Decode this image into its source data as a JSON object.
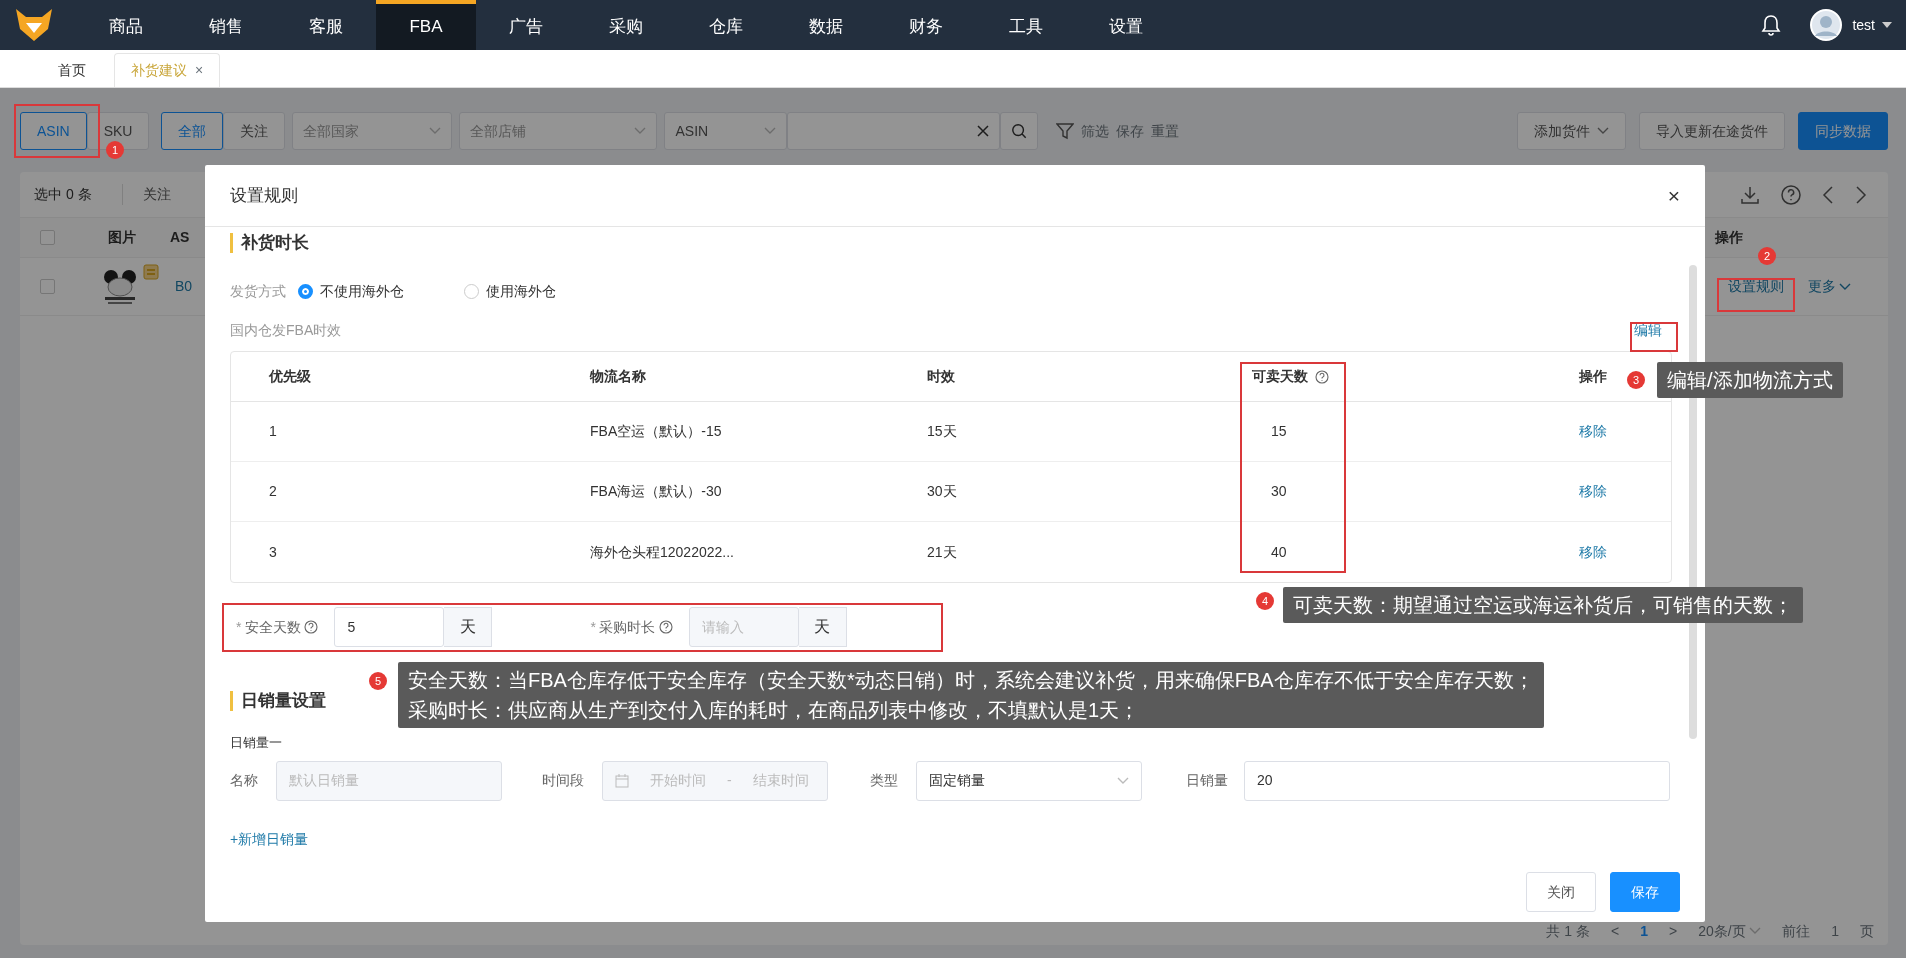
{
  "top_nav": {
    "menu": [
      {
        "label": "商品",
        "selected": false
      },
      {
        "label": "销售",
        "selected": false
      },
      {
        "label": "客服",
        "selected": false
      },
      {
        "label": "FBA",
        "selected": true
      },
      {
        "label": "广告",
        "selected": false
      },
      {
        "label": "采购",
        "selected": false
      },
      {
        "label": "仓库",
        "selected": false
      },
      {
        "label": "数据",
        "selected": false
      },
      {
        "label": "财务",
        "selected": false
      },
      {
        "label": "工具",
        "selected": false
      },
      {
        "label": "设置",
        "selected": false
      }
    ],
    "user": "test"
  },
  "page_tabs": [
    {
      "label": "首页",
      "selected": false
    },
    {
      "label": "补货建议",
      "selected": true,
      "close": "×"
    }
  ],
  "toolbar": {
    "mode_buttons": [
      {
        "label": "ASIN",
        "selected": true
      },
      {
        "label": "SKU",
        "selected": false
      }
    ],
    "scope_buttons": [
      {
        "label": "全部",
        "selected": true
      },
      {
        "label": "关注",
        "selected": false
      }
    ],
    "selects": [
      {
        "placeholder": "全部国家"
      },
      {
        "placeholder": "全部店铺"
      }
    ],
    "search_type": "ASIN",
    "links": [
      "筛选",
      "保存",
      "重置"
    ],
    "buttons": [
      {
        "label": "添加货件",
        "kind": "dropdown"
      },
      {
        "label": "导入更新在途货件",
        "kind": "default"
      },
      {
        "label": "同步数据",
        "kind": "primary"
      }
    ]
  },
  "list": {
    "selected_count": "选中 0 条",
    "follow": "关注",
    "select_all": {
      "checked": false
    },
    "columns": [
      "图片",
      "AS"
    ],
    "row_checked": false,
    "row_id": "B0",
    "action_header": "操作",
    "row_actions": [
      "设置规则",
      "更多"
    ]
  },
  "pagination": {
    "total": "共 1 条",
    "prev": "<",
    "page": "1",
    "next": ">",
    "page_size": "20条/页",
    "goto": "前往",
    "goto_value": "1",
    "unit": "页"
  },
  "modal": {
    "title": "设置规则",
    "close": "×",
    "restock": {
      "heading": "补货时长",
      "ship_label": "发货方式",
      "ship_options": [
        {
          "label": "不使用海外仓",
          "selected": true
        },
        {
          "label": "使用海外仓",
          "selected": false
        }
      ],
      "subheading": "国内仓发FBA时效",
      "edit_link": "编辑",
      "columns": [
        "优先级",
        "物流名称",
        "时效",
        "可卖天数",
        "操作"
      ],
      "rows": [
        {
          "priority": "1",
          "name": "FBA空运（默认）-15",
          "duration": "15天",
          "sell_days": "15",
          "action": "移除"
        },
        {
          "priority": "2",
          "name": "FBA海运（默认）-30",
          "duration": "30天",
          "sell_days": "30",
          "action": "移除"
        },
        {
          "priority": "3",
          "name": "海外仓头程12022022...",
          "duration": "21天",
          "sell_days": "40",
          "action": "移除"
        }
      ],
      "fields": [
        {
          "required_mark": "*",
          "label": "安全天数",
          "value": "5",
          "unit": "天",
          "disabled": false
        },
        {
          "required_mark": "*",
          "label": "采购时长",
          "placeholder": "请输入",
          "unit": "天",
          "disabled": true
        }
      ]
    },
    "daily_sales": {
      "heading": "日销量设置",
      "group_title": "日销量一",
      "name_label": "名称",
      "name_placeholder": "默认日销量",
      "period_label": "时间段",
      "start_placeholder": "开始时间",
      "separator": "-",
      "end_placeholder": "结束时间",
      "type_label": "类型",
      "type_value": "固定销量",
      "qty_label": "日销量",
      "qty_value": "20",
      "add_link": "+新增日销量"
    },
    "footer": [
      {
        "label": "关闭",
        "kind": "default"
      },
      {
        "label": "保存",
        "kind": "primary"
      }
    ]
  },
  "annotations": [
    {
      "number": "1",
      "framed": true
    },
    {
      "number": "2",
      "framed": true
    },
    {
      "number": "3",
      "framed": true,
      "note": [
        "编辑/添加物流方式"
      ]
    },
    {
      "number": "4",
      "framed": true,
      "note": [
        "可卖天数：期望通过空运或海运补货后，可销售的天数；"
      ]
    },
    {
      "number": "5",
      "framed": true,
      "note": [
        "安全天数：当FBA仓库存低于安全库存（安全天数*动态日销）时，系统会建议补货，用来确保FBA仓库存不低于安全库存天数；",
        "采购时长：供应商从生产到交付入库的耗时，在商品列表中修改，不填默认是1天；"
      ]
    }
  ]
}
